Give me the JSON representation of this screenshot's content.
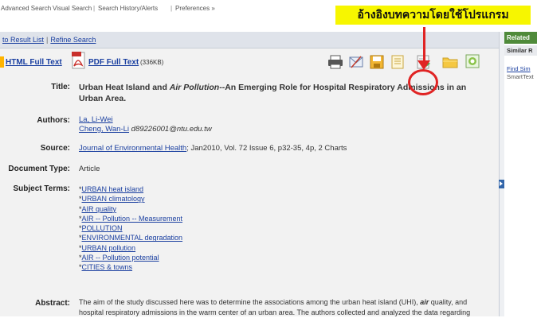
{
  "topnav": {
    "items": [
      "Advanced Search",
      "Visual Search",
      "Search History/Alerts",
      "Preferences »"
    ]
  },
  "annotation": {
    "text": "อ้างอิงบทความโดยใช้โปรแกรม"
  },
  "panel": {
    "back_link": "to Result List",
    "refine_link": "Refine Search"
  },
  "fulltext": {
    "html_label": "HTML Full Text",
    "pdf_label": "PDF Full Text",
    "pdf_size": "(336KB)"
  },
  "toolbar": {
    "icons": [
      "print-icon",
      "email-icon",
      "save-icon",
      "cite-icon",
      "export-icon",
      "folder-icon",
      "add-icon"
    ]
  },
  "record": {
    "title_label": "Title:",
    "title_part1": "Urban Heat Island and ",
    "title_em": "Air Pollution",
    "title_part2": "--An Emerging Role for Hospital Respiratory Admissions in an Urban Area.",
    "authors_label": "Authors:",
    "author1": "La, Li-Wei",
    "author2": "Cheng, Wan-Li",
    "author2_email": "d89226001@ntu.edu.tw",
    "source_label": "Source:",
    "source_journal": "Journal of Environmental Health",
    "source_rest": "; Jan2010, Vol. 72 Issue 6, p32-35, 4p, 2 Charts",
    "doctype_label": "Document Type:",
    "doctype_value": "Article",
    "subjects_label": "Subject Terms:",
    "subjects": [
      "URBAN heat island",
      "URBAN climatology",
      "AIR quality",
      "AIR -- Pollution -- Measurement",
      "POLLUTION",
      "ENVIRONMENTAL degradation",
      "URBAN pollution",
      "AIR -- Pollution potential",
      "CITIES & towns"
    ],
    "abstract_label": "Abstract:",
    "abstract_line1a": "The aim of the study discussed here was to determine the associations among the urban heat island (UHI), ",
    "abstract_line1em": "air",
    "abstract_line1b": " quality, and",
    "abstract_line2": "hospital respiratory admissions in the warm center of an urban area. The authors collected and analyzed the data regarding"
  },
  "related": {
    "header": "Related",
    "similar": "Similar R",
    "link": "Find Sim",
    "text": "SmartText"
  }
}
